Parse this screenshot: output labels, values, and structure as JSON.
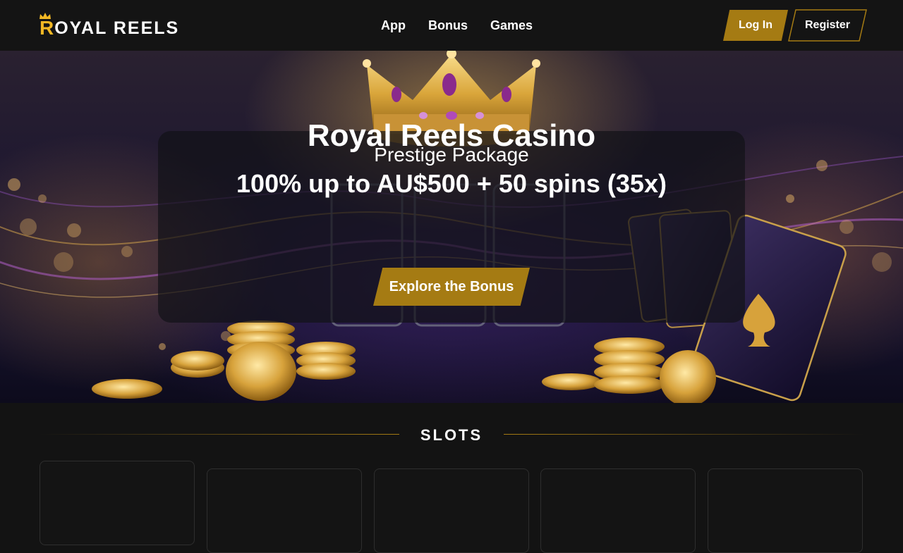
{
  "brand": {
    "logo_initial": "R",
    "logo_rest": "OYAL REELS",
    "accent_color": "#a57b13",
    "logo_gold": "#f2b824"
  },
  "nav": {
    "items": [
      {
        "label": "App"
      },
      {
        "label": "Bonus"
      },
      {
        "label": "Games"
      }
    ]
  },
  "auth": {
    "login_label": "Log In",
    "register_label": "Register"
  },
  "hero": {
    "title": "Royal Reels Casino",
    "subtitle": "Prestige Package",
    "offer": "100% up to AU$500 + 50 spins (35x)",
    "cta_label": "Explore the Bonus",
    "illustration": "crown, slot reels, golden chips and playing cards"
  },
  "slots": {
    "heading": "SLOTS",
    "cards": [
      {},
      {},
      {},
      {},
      {}
    ]
  }
}
